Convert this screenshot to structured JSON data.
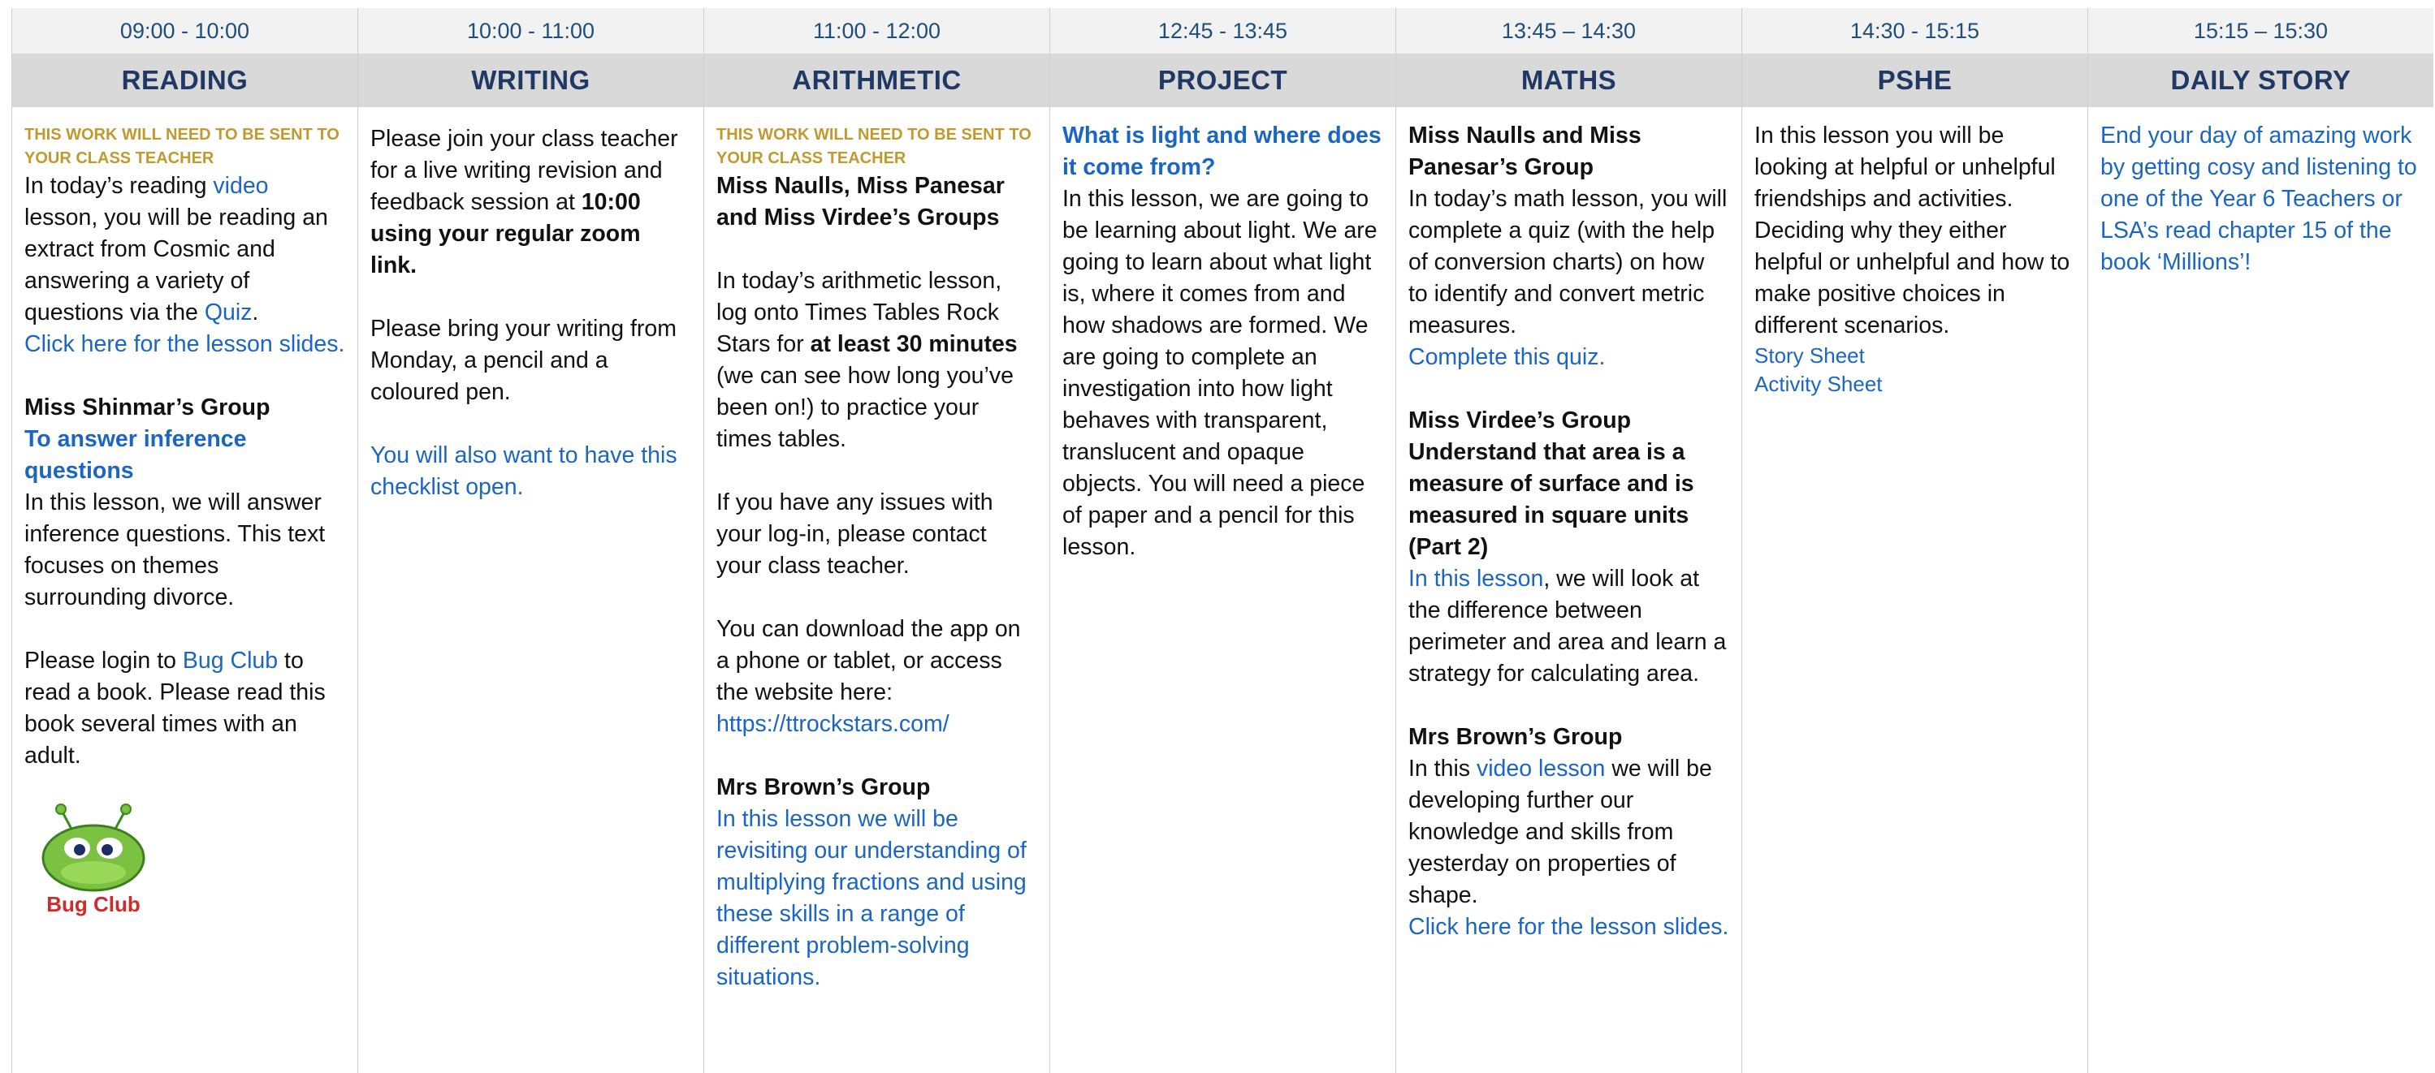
{
  "columns": [
    {
      "time": "09:00 - 10:00",
      "subject": "READING"
    },
    {
      "time": "10:00 - 11:00",
      "subject": "WRITING"
    },
    {
      "time": "11:00 - 12:00",
      "subject": "ARITHMETIC"
    },
    {
      "time": "12:45 - 13:45",
      "subject": "PROJECT"
    },
    {
      "time": "13:45 – 14:30",
      "subject": "MATHS"
    },
    {
      "time": "14:30 - 15:15",
      "subject": "PSHE"
    },
    {
      "time": "15:15 – 15:30",
      "subject": "DAILY STORY"
    }
  ],
  "reading": {
    "note": "THIS WORK WILL NEED TO BE SENT TO YOUR CLASS TEACHER",
    "p1_a": "In today’s reading ",
    "p1_link": "video",
    "p1_b": " lesson, you will be reading an extract from Cosmic and answering a variety of questions via the ",
    "p1_quiz": "Quiz",
    "p1_c": ".",
    "slides_link": "Click here for the lesson slides.",
    "group": "Miss Shinmar’s Group",
    "group_title": "To answer inference questions",
    "p2": "In this lesson, we will answer inference questions. This text focuses on themes surrounding divorce.",
    "p3_a": "Please login to ",
    "p3_link": "Bug Club",
    "p3_b": " to read a book. Please read this book several times with an adult.",
    "logo_text": "Bug Club"
  },
  "writing": {
    "p1_a": "Please join your class teacher for a live writing revision and feedback session at ",
    "p1_bold": "10:00 using your regular zoom link.",
    "p2": "Please bring your writing from Monday, a pencil and a coloured pen.",
    "p3_link": "You will also want to have this checklist open."
  },
  "arithmetic": {
    "note": "THIS WORK WILL NEED TO BE SENT TO YOUR CLASS TEACHER",
    "group1": "Miss Naulls, Miss Panesar and Miss Virdee’s Groups",
    "p1_a": "In today’s arithmetic lesson, log onto Times Tables Rock Stars for ",
    "p1_bold": "at least 30 minutes",
    "p1_b": " (we can see how long you’ve been on!) to practice your times tables.",
    "p2": "If you have any issues with your log-in, please contact your class teacher.",
    "p3": "You can download the app on a phone or tablet, or access the website here:",
    "url": "https://ttrockstars.com/",
    "group2": "Mrs Brown’s Group",
    "p4_link": "In this lesson we will be revisiting our understanding of multiplying fractions and using these skills in a range of different problem-solving situations."
  },
  "project": {
    "title": "What is light and where does it come from?",
    "p1": "In this lesson, we are going to be learning about light. We are going to learn about what light is, where it comes from and how shadows are formed. We are going to complete an investigation into how light behaves with transparent, translucent and opaque objects. You will need a piece of paper and a pencil for this lesson."
  },
  "maths": {
    "group1": "Miss Naulls and Miss Panesar’s Group",
    "p1": "In today’s math lesson, you will complete a quiz (with the help of conversion charts) on how to identify and convert metric measures.",
    "quiz_link": "Complete this quiz.",
    "group2": "Miss Virdee’s Group",
    "group2_title": "Understand that area is a measure of surface and is measured in square units (Part 2)",
    "p2_link": "In this lesson",
    "p2_b": ", we will look at the difference between perimeter and area and learn a strategy for calculating area.",
    "group3": "Mrs Brown’s Group",
    "p3_a": "In this ",
    "p3_link": "video lesson",
    "p3_b": " we will be developing further our knowledge and skills from yesterday on properties of shape.",
    "slides_link": "Click here for the lesson slides."
  },
  "pshe": {
    "p1": "In this lesson you will be looking at helpful or unhelpful friendships and activities. Deciding why they either helpful or unhelpful and how to make positive choices in different scenarios.",
    "link1": "Story Sheet",
    "link2": "Activity Sheet"
  },
  "story": {
    "p1": "End your day of amazing work by getting cosy and listening to one of the Year 6 Teachers or LSA’s read chapter 15 of the book ‘Millions’!"
  }
}
